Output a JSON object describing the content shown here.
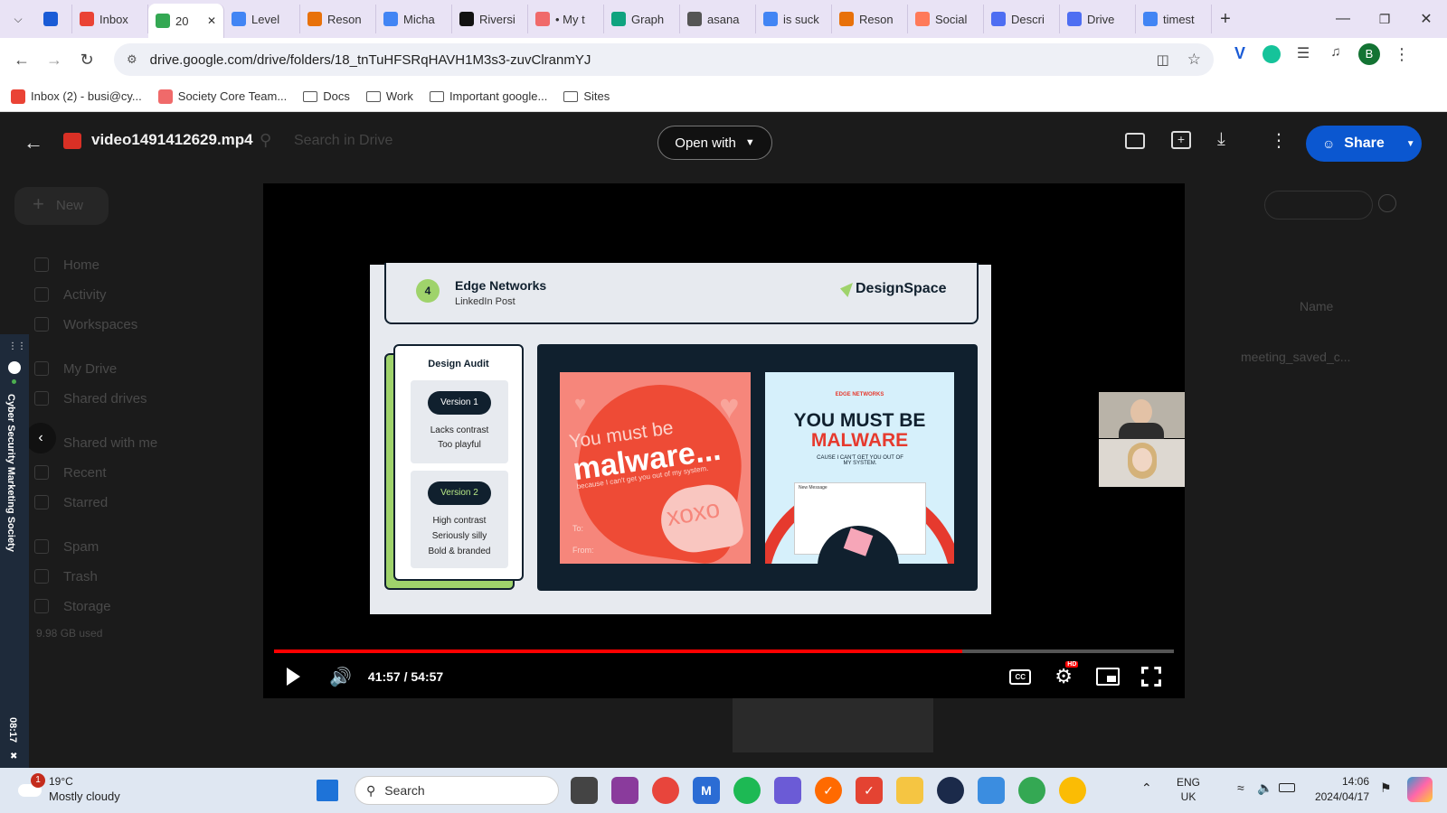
{
  "tabs": [
    {
      "label": "",
      "icon": "vivaldi-icon"
    },
    {
      "label": "Inbox",
      "icon": "gmail-icon"
    },
    {
      "label": "20",
      "icon": "drive-icon",
      "active": true
    },
    {
      "label": "Level",
      "icon": "docs-icon"
    },
    {
      "label": "Reson",
      "icon": "reson-icon"
    },
    {
      "label": "Micha",
      "icon": "docs-icon"
    },
    {
      "label": "Riversi",
      "icon": "riverside-icon"
    },
    {
      "label": "• My t",
      "icon": "asana-icon"
    },
    {
      "label": "Graph",
      "icon": "chatgpt-icon"
    },
    {
      "label": "asana",
      "icon": "globe-icon"
    },
    {
      "label": "is suck",
      "icon": "google-icon"
    },
    {
      "label": "Reson",
      "icon": "reson-icon"
    },
    {
      "label": "Social",
      "icon": "hubspot-icon"
    },
    {
      "label": "Descri",
      "icon": "doc-icon"
    },
    {
      "label": "Drive",
      "icon": "doc-icon"
    },
    {
      "label": "timest",
      "icon": "google-icon"
    }
  ],
  "address": {
    "url": "drive.google.com/drive/folders/18_tnTuHFSRqHAVH1M3s3-zuvClranmYJ"
  },
  "profile_initial": "B",
  "bookmarks": [
    {
      "label": "Inbox (2) - busi@cy...",
      "icon": "gmail-icon"
    },
    {
      "label": "Society Core Team...",
      "icon": "asana-icon"
    },
    {
      "label": "Docs",
      "icon": "folder-icon"
    },
    {
      "label": "Work",
      "icon": "folder-icon"
    },
    {
      "label": "Important google...",
      "icon": "folder-icon"
    },
    {
      "label": "Sites",
      "icon": "folder-icon"
    }
  ],
  "drive": {
    "search_placeholder": "Search in Drive",
    "new_label": "New",
    "nav": [
      "Home",
      "Activity",
      "Workspaces",
      "My Drive",
      "Shared drives",
      "Shared with me",
      "Recent",
      "Starred",
      "Spam",
      "Trash",
      "Storage"
    ],
    "storage_text": "9.98 GB used",
    "sort_label": "Name",
    "file_name": "meeting_saved_c..."
  },
  "viewer": {
    "file_title": "video1491412629.mp4",
    "open_with": "Open with",
    "share": "Share"
  },
  "slide": {
    "number": "4",
    "title": "Edge Networks",
    "subtitle": "LinkedIn Post",
    "brand": "DesignSpace",
    "audit_title": "Design Audit",
    "v1_label": "Version 1",
    "v1_notes": [
      "Lacks contrast",
      "Too playful"
    ],
    "v2_label": "Version 2",
    "v2_notes": [
      "High contrast",
      "Seriously silly",
      "Bold & branded"
    ],
    "img1_line1": "You must be",
    "img1_line2": "malware...",
    "img1_line3": "because I can't get you out of my system.",
    "img1_to": "To:",
    "img1_from": "From:",
    "img1_xoxo": "xoxo",
    "img2_brand": "EDGE NETWORKS",
    "img2_line1": "YOU MUST BE",
    "img2_line2": "MALWARE",
    "img2_line3": "CAUSE I CAN'T GET YOU OUT OF MY SYSTEM.",
    "img2_email_title": "New Message"
  },
  "player": {
    "time": "41:57 / 54:57",
    "progress": 0.765,
    "hd_badge": "HD"
  },
  "side_strip": {
    "label": "Cyber Security Marketing Society",
    "timer": "08:17"
  },
  "taskbar": {
    "weather_temp": "19°C",
    "weather_desc": "Mostly cloudy",
    "weather_badge": "1",
    "search": "Search",
    "lang1": "ENG",
    "lang2": "UK",
    "time": "14:06",
    "date": "2024/04/17"
  },
  "colors": {
    "accent_red": "#ff0000",
    "share_blue": "#0b57d0",
    "slide_navy": "#10202e",
    "slide_green": "#9fd36b"
  }
}
